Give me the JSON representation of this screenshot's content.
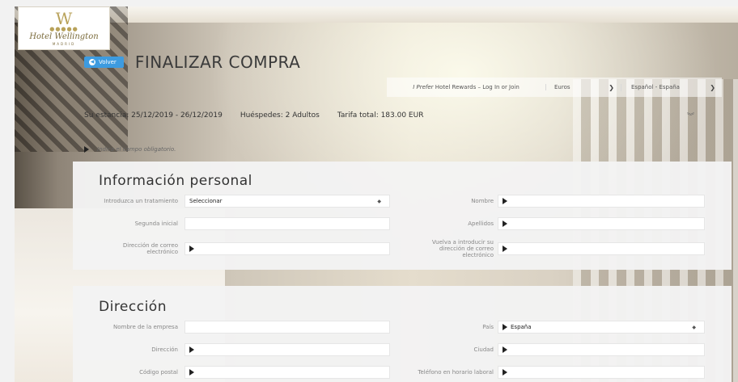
{
  "logo": {
    "mark": "W",
    "name": "Hotel Wellington",
    "city": "MADRID"
  },
  "header": {
    "back_label": "Volver",
    "title": "FINALIZAR COMPRA",
    "rewards_prefix": "I Prefer",
    "rewards_label": "Hotel Rewards – Log In or Join",
    "currency": "Euros",
    "language": "Español - España"
  },
  "summary": {
    "stay": "Su estancia: 25/12/2019 - 26/12/2019",
    "guests": "Huéspedes: 2 Adultos",
    "rate": "Tarifa total: 183.00 EUR"
  },
  "required_note": "Indica el campo obligatorio.",
  "personal": {
    "title": "Información personal",
    "salutation_label": "Introduzca un tratamiento",
    "salutation_value": "Seleccionar",
    "first_name_label": "Nombre",
    "middle_initial_label": "Segunda inicial",
    "last_name_label": "Apellidos",
    "email_label": "Dirección de correo electrónico",
    "email_confirm_label": "Vuelva a introducir su dirección de correo electrónico"
  },
  "address": {
    "title": "Dirección",
    "company_label": "Nombre de la empresa",
    "country_label": "País",
    "country_value": "España",
    "street_label": "Dirección",
    "city_label": "Ciudad",
    "postal_label": "Código postal",
    "work_phone_label": "Teléfono en horario laboral"
  },
  "icons": {
    "back": "back-circle-icon",
    "chevron": "chevron-down-icon",
    "expand": "double-chevron-down-icon",
    "required": "required-arrow-icon",
    "select": "select-indicator-icon"
  }
}
